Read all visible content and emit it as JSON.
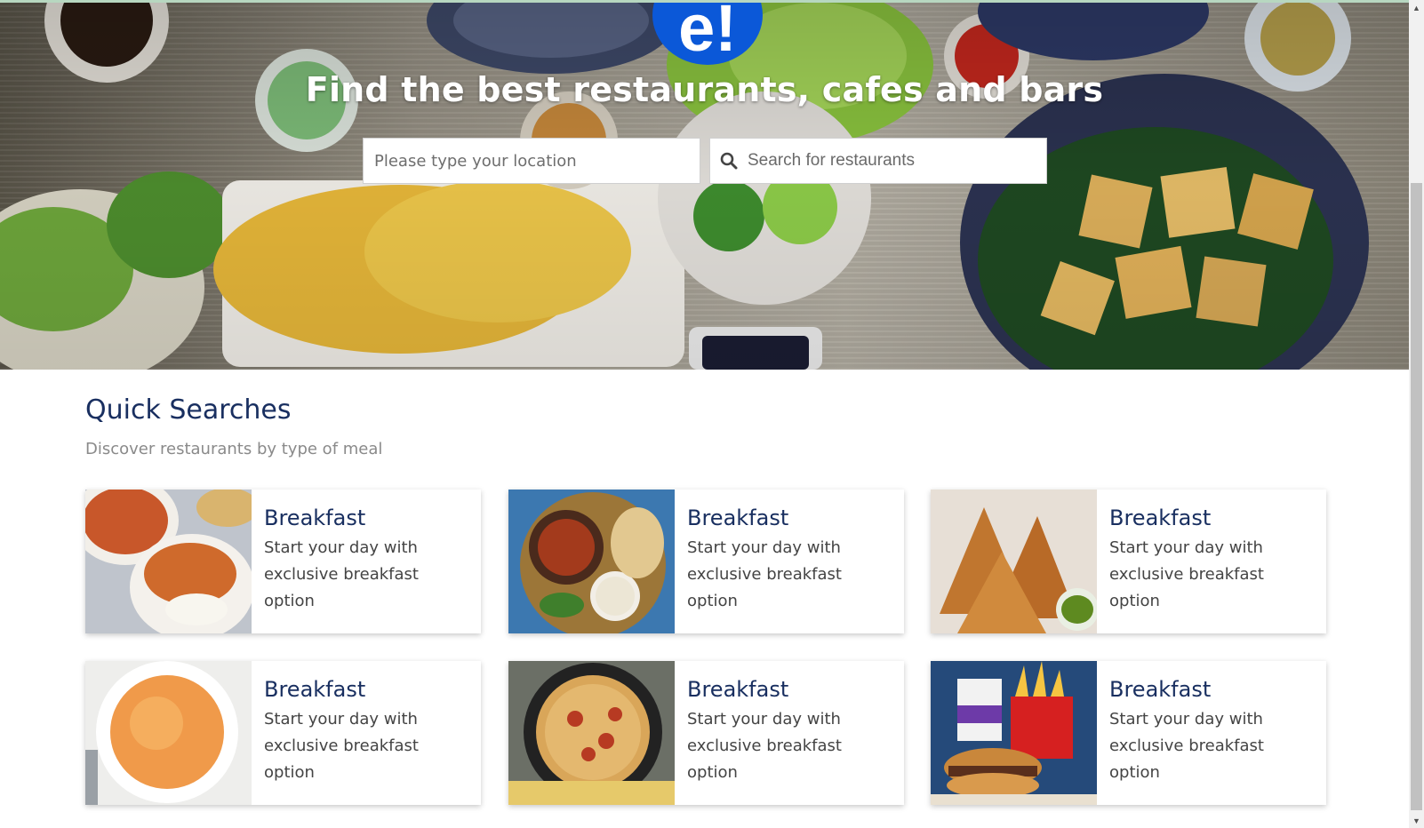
{
  "brand": {
    "logo_text": "e!",
    "logo_color": "#0b58d8"
  },
  "hero": {
    "title": "Find the best restaurants, cafes and bars",
    "location_placeholder": "Please type your location",
    "search_placeholder": "Search for restaurants"
  },
  "quick_searches": {
    "title": "Quick Searches",
    "subtitle": "Discover restaurants by type of meal",
    "cards": [
      {
        "title": "Breakfast",
        "description": "Start your day with exclusive breakfast option",
        "image": "butter-chicken-photo"
      },
      {
        "title": "Breakfast",
        "description": "Start your day with exclusive breakfast option",
        "image": "curry-platter-photo"
      },
      {
        "title": "Breakfast",
        "description": "Start your day with exclusive breakfast option",
        "image": "samosa-photo"
      },
      {
        "title": "Breakfast",
        "description": "Start your day with exclusive breakfast option",
        "image": "mac-and-cheese-photo"
      },
      {
        "title": "Breakfast",
        "description": "Start your day with exclusive breakfast option",
        "image": "pan-pizza-photo"
      },
      {
        "title": "Breakfast",
        "description": "Start your day with exclusive breakfast option",
        "image": "burger-fries-photo"
      }
    ]
  },
  "colors": {
    "heading": "#192f60",
    "subtitle": "#8a8a8a",
    "body_text": "#444444"
  }
}
